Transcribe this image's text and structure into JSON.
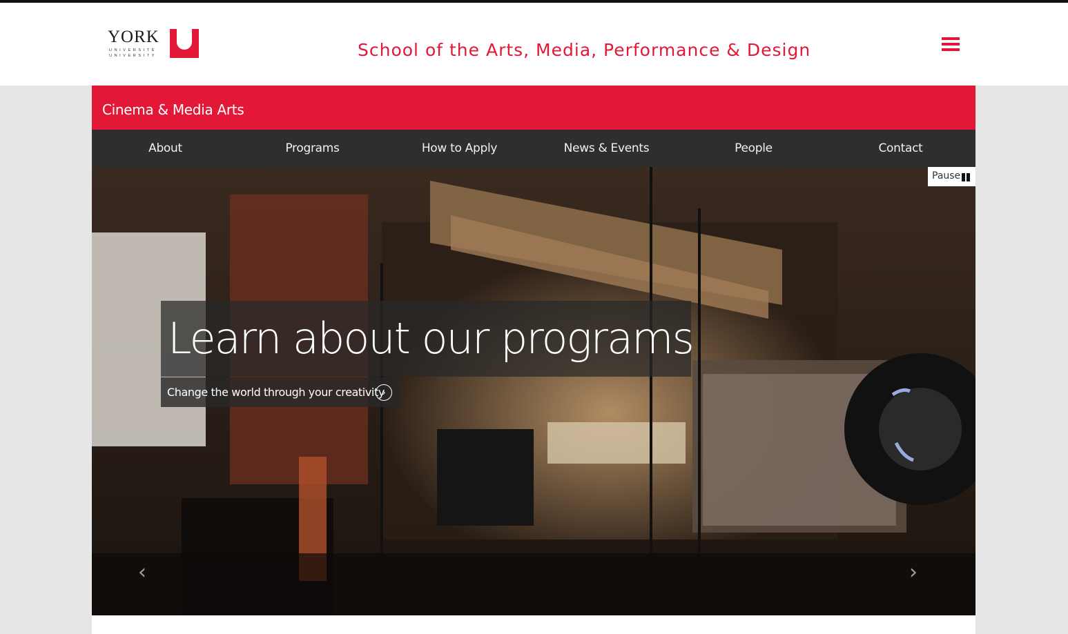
{
  "header": {
    "logo": {
      "word": "YORK",
      "sub": "UNIVERSITÉ",
      "sub2": "UNIVERSITY",
      "mark": "U"
    },
    "school_title": "School of the Arts, Media, Performance & Design",
    "menu_icon": "hamburger-menu-icon"
  },
  "department": {
    "name": "Cinema & Media Arts"
  },
  "nav": {
    "items": [
      {
        "label": "About"
      },
      {
        "label": "Programs"
      },
      {
        "label": "How to Apply"
      },
      {
        "label": "News & Events"
      },
      {
        "label": "People"
      },
      {
        "label": "Contact"
      }
    ]
  },
  "hero": {
    "pause_label": "Pause",
    "title": "Learn about our programs",
    "subtitle": "Change the world through your creativity",
    "prev_icon": "chevron-left-icon",
    "next_icon": "chevron-right-icon"
  },
  "colors": {
    "brand_red": "#e31837",
    "nav_bg": "#2e2e2e"
  }
}
